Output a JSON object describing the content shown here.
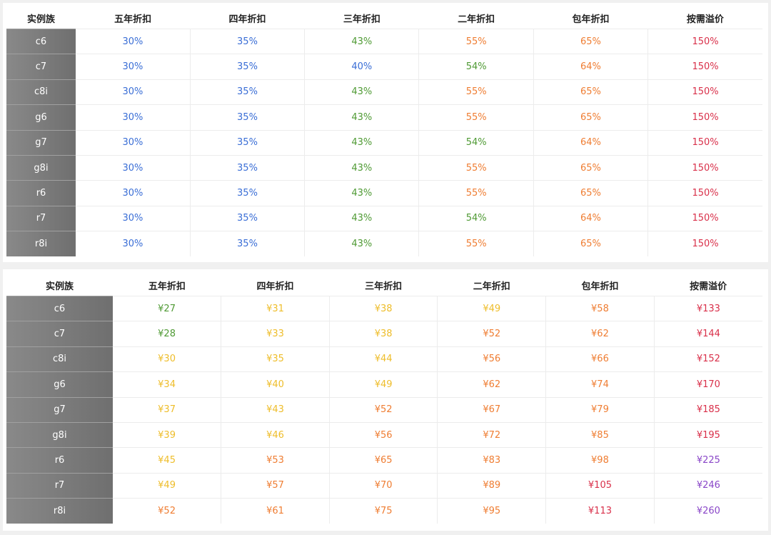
{
  "colors": {
    "blue": "#3a6ed6",
    "green": "#4f9a34",
    "orange": "#ef7d32",
    "red": "#d9304a",
    "yellow": "#eebd2a",
    "purple": "#8a47c8"
  },
  "discount_table": {
    "headers": [
      "实例族",
      "五年折扣",
      "四年折扣",
      "三年折扣",
      "二年折扣",
      "包年折扣",
      "按需溢价"
    ],
    "rows": [
      {
        "family": "c6",
        "cells": [
          {
            "v": "30%",
            "c": "blue"
          },
          {
            "v": "35%",
            "c": "blue"
          },
          {
            "v": "43%",
            "c": "green"
          },
          {
            "v": "55%",
            "c": "orange"
          },
          {
            "v": "65%",
            "c": "orange"
          },
          {
            "v": "150%",
            "c": "red"
          }
        ]
      },
      {
        "family": "c7",
        "cells": [
          {
            "v": "30%",
            "c": "blue"
          },
          {
            "v": "35%",
            "c": "blue"
          },
          {
            "v": "40%",
            "c": "blue"
          },
          {
            "v": "54%",
            "c": "green"
          },
          {
            "v": "64%",
            "c": "orange"
          },
          {
            "v": "150%",
            "c": "red"
          }
        ]
      },
      {
        "family": "c8i",
        "cells": [
          {
            "v": "30%",
            "c": "blue"
          },
          {
            "v": "35%",
            "c": "blue"
          },
          {
            "v": "43%",
            "c": "green"
          },
          {
            "v": "55%",
            "c": "orange"
          },
          {
            "v": "65%",
            "c": "orange"
          },
          {
            "v": "150%",
            "c": "red"
          }
        ]
      },
      {
        "family": "g6",
        "cells": [
          {
            "v": "30%",
            "c": "blue"
          },
          {
            "v": "35%",
            "c": "blue"
          },
          {
            "v": "43%",
            "c": "green"
          },
          {
            "v": "55%",
            "c": "orange"
          },
          {
            "v": "65%",
            "c": "orange"
          },
          {
            "v": "150%",
            "c": "red"
          }
        ]
      },
      {
        "family": "g7",
        "cells": [
          {
            "v": "30%",
            "c": "blue"
          },
          {
            "v": "35%",
            "c": "blue"
          },
          {
            "v": "43%",
            "c": "green"
          },
          {
            "v": "54%",
            "c": "green"
          },
          {
            "v": "64%",
            "c": "orange"
          },
          {
            "v": "150%",
            "c": "red"
          }
        ]
      },
      {
        "family": "g8i",
        "cells": [
          {
            "v": "30%",
            "c": "blue"
          },
          {
            "v": "35%",
            "c": "blue"
          },
          {
            "v": "43%",
            "c": "green"
          },
          {
            "v": "55%",
            "c": "orange"
          },
          {
            "v": "65%",
            "c": "orange"
          },
          {
            "v": "150%",
            "c": "red"
          }
        ]
      },
      {
        "family": "r6",
        "cells": [
          {
            "v": "30%",
            "c": "blue"
          },
          {
            "v": "35%",
            "c": "blue"
          },
          {
            "v": "43%",
            "c": "green"
          },
          {
            "v": "55%",
            "c": "orange"
          },
          {
            "v": "65%",
            "c": "orange"
          },
          {
            "v": "150%",
            "c": "red"
          }
        ]
      },
      {
        "family": "r7",
        "cells": [
          {
            "v": "30%",
            "c": "blue"
          },
          {
            "v": "35%",
            "c": "blue"
          },
          {
            "v": "43%",
            "c": "green"
          },
          {
            "v": "54%",
            "c": "green"
          },
          {
            "v": "64%",
            "c": "orange"
          },
          {
            "v": "150%",
            "c": "red"
          }
        ]
      },
      {
        "family": "r8i",
        "cells": [
          {
            "v": "30%",
            "c": "blue"
          },
          {
            "v": "35%",
            "c": "blue"
          },
          {
            "v": "43%",
            "c": "green"
          },
          {
            "v": "55%",
            "c": "orange"
          },
          {
            "v": "65%",
            "c": "orange"
          },
          {
            "v": "150%",
            "c": "red"
          }
        ]
      }
    ]
  },
  "price_table": {
    "headers": [
      "实例族",
      "五年折扣",
      "四年折扣",
      "三年折扣",
      "二年折扣",
      "包年折扣",
      "按需溢价"
    ],
    "rows": [
      {
        "family": "c6",
        "cells": [
          {
            "v": "¥27",
            "c": "green"
          },
          {
            "v": "¥31",
            "c": "yellow"
          },
          {
            "v": "¥38",
            "c": "yellow"
          },
          {
            "v": "¥49",
            "c": "yellow"
          },
          {
            "v": "¥58",
            "c": "orange"
          },
          {
            "v": "¥133",
            "c": "red"
          }
        ]
      },
      {
        "family": "c7",
        "cells": [
          {
            "v": "¥28",
            "c": "green"
          },
          {
            "v": "¥33",
            "c": "yellow"
          },
          {
            "v": "¥38",
            "c": "yellow"
          },
          {
            "v": "¥52",
            "c": "orange"
          },
          {
            "v": "¥62",
            "c": "orange"
          },
          {
            "v": "¥144",
            "c": "red"
          }
        ]
      },
      {
        "family": "c8i",
        "cells": [
          {
            "v": "¥30",
            "c": "yellow"
          },
          {
            "v": "¥35",
            "c": "yellow"
          },
          {
            "v": "¥44",
            "c": "yellow"
          },
          {
            "v": "¥56",
            "c": "orange"
          },
          {
            "v": "¥66",
            "c": "orange"
          },
          {
            "v": "¥152",
            "c": "red"
          }
        ]
      },
      {
        "family": "g6",
        "cells": [
          {
            "v": "¥34",
            "c": "yellow"
          },
          {
            "v": "¥40",
            "c": "yellow"
          },
          {
            "v": "¥49",
            "c": "yellow"
          },
          {
            "v": "¥62",
            "c": "orange"
          },
          {
            "v": "¥74",
            "c": "orange"
          },
          {
            "v": "¥170",
            "c": "red"
          }
        ]
      },
      {
        "family": "g7",
        "cells": [
          {
            "v": "¥37",
            "c": "yellow"
          },
          {
            "v": "¥43",
            "c": "yellow"
          },
          {
            "v": "¥52",
            "c": "orange"
          },
          {
            "v": "¥67",
            "c": "orange"
          },
          {
            "v": "¥79",
            "c": "orange"
          },
          {
            "v": "¥185",
            "c": "red"
          }
        ]
      },
      {
        "family": "g8i",
        "cells": [
          {
            "v": "¥39",
            "c": "yellow"
          },
          {
            "v": "¥46",
            "c": "yellow"
          },
          {
            "v": "¥56",
            "c": "orange"
          },
          {
            "v": "¥72",
            "c": "orange"
          },
          {
            "v": "¥85",
            "c": "orange"
          },
          {
            "v": "¥195",
            "c": "red"
          }
        ]
      },
      {
        "family": "r6",
        "cells": [
          {
            "v": "¥45",
            "c": "yellow"
          },
          {
            "v": "¥53",
            "c": "orange"
          },
          {
            "v": "¥65",
            "c": "orange"
          },
          {
            "v": "¥83",
            "c": "orange"
          },
          {
            "v": "¥98",
            "c": "orange"
          },
          {
            "v": "¥225",
            "c": "purple"
          }
        ]
      },
      {
        "family": "r7",
        "cells": [
          {
            "v": "¥49",
            "c": "yellow"
          },
          {
            "v": "¥57",
            "c": "orange"
          },
          {
            "v": "¥70",
            "c": "orange"
          },
          {
            "v": "¥89",
            "c": "orange"
          },
          {
            "v": "¥105",
            "c": "red"
          },
          {
            "v": "¥246",
            "c": "purple"
          }
        ]
      },
      {
        "family": "r8i",
        "cells": [
          {
            "v": "¥52",
            "c": "orange"
          },
          {
            "v": "¥61",
            "c": "orange"
          },
          {
            "v": "¥75",
            "c": "orange"
          },
          {
            "v": "¥95",
            "c": "orange"
          },
          {
            "v": "¥113",
            "c": "red"
          },
          {
            "v": "¥260",
            "c": "purple"
          }
        ]
      }
    ]
  }
}
